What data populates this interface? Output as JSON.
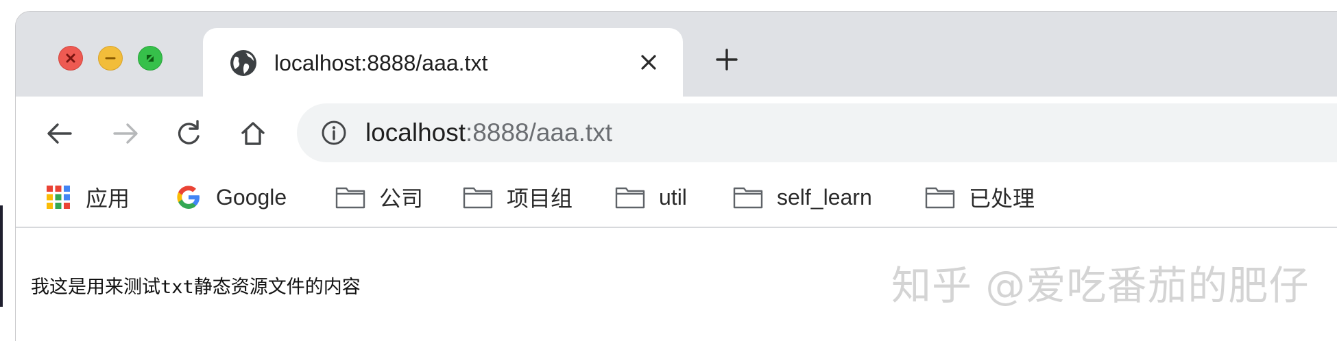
{
  "window": {
    "traffic_lights": [
      "close",
      "minimize",
      "zoom"
    ]
  },
  "tab": {
    "title": "localhost:8888/aaa.txt",
    "icon": "globe-icon"
  },
  "toolbar": {
    "url_host": "localhost",
    "url_rest": ":8888/aaa.txt"
  },
  "bookmarks": {
    "apps_label": "应用",
    "google_label": "Google",
    "folders": [
      "公司",
      "项目组",
      "util",
      "self_learn",
      "已处理"
    ]
  },
  "content": {
    "text": "我这是用来测试txt静态资源文件的内容"
  },
  "watermark": "知乎 @爱吃番茄的肥仔",
  "colors": {
    "tab_strip": "#dfe1e5",
    "omnibox": "#f1f3f4",
    "close_red": "#ee5a52",
    "minimize_yellow": "#f2bd3a",
    "zoom_green": "#36c04a"
  }
}
